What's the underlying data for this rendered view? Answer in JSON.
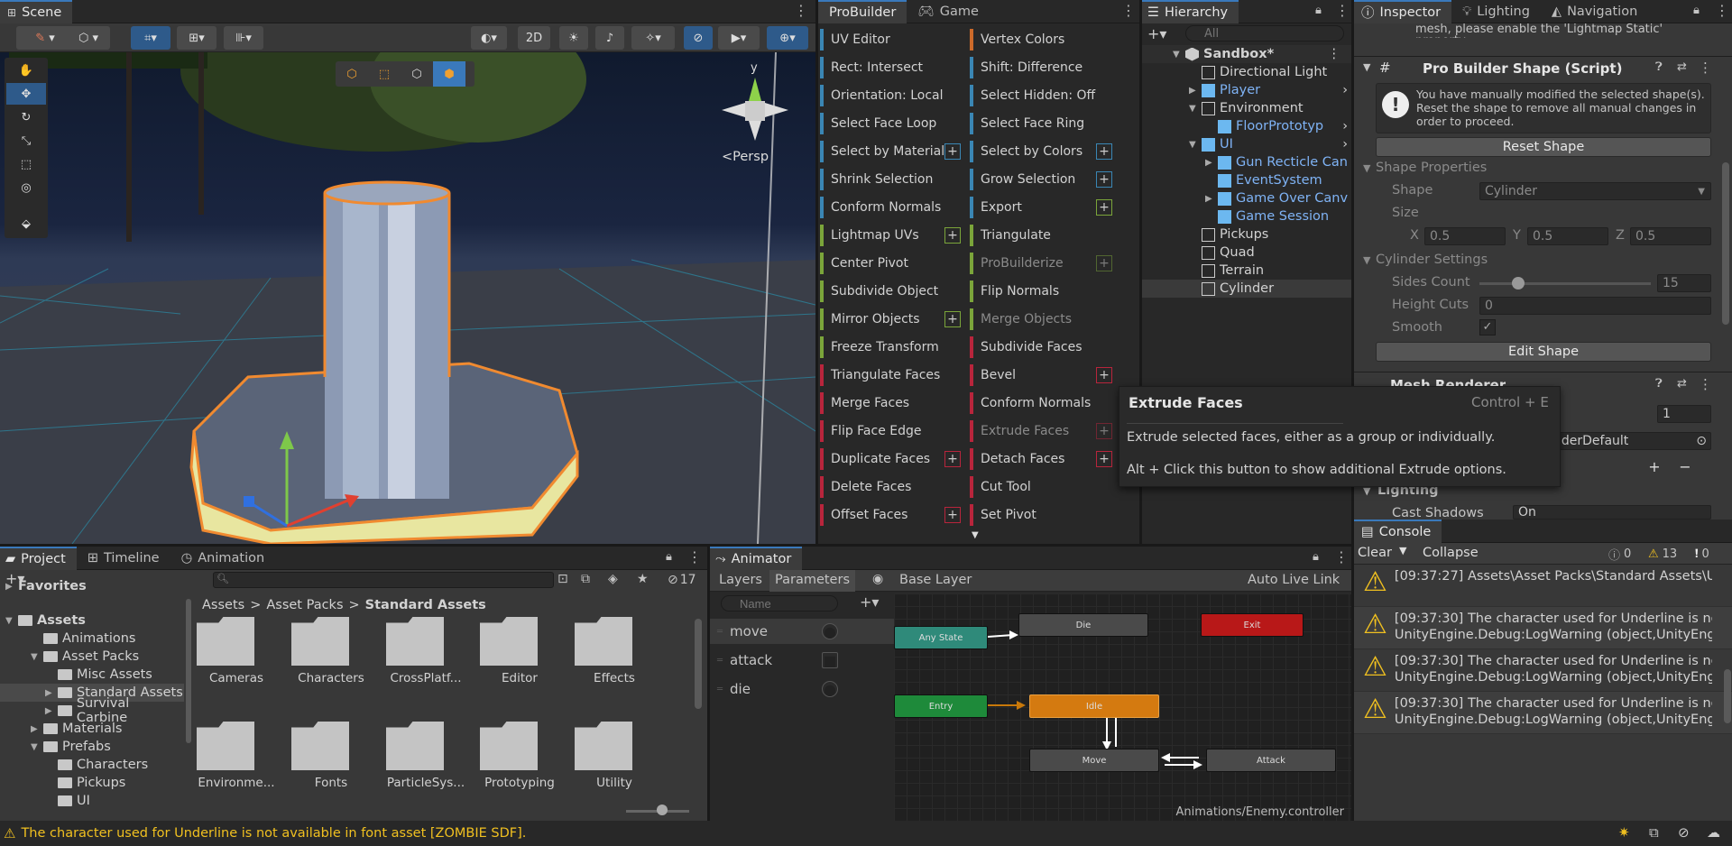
{
  "scene": {
    "tab": "Scene",
    "twod": "2D",
    "persp": "<Persp",
    "axis_y": "y"
  },
  "probuilder": {
    "tabs": [
      "ProBuilder",
      "Game"
    ],
    "left": [
      "UV Editor",
      "Rect: Intersect",
      "Orientation: Local",
      "Select Face Loop",
      "Select by Material",
      "Shrink Selection",
      "Conform Normals",
      "Lightmap UVs",
      "Center Pivot",
      "Subdivide Object",
      "Mirror Objects",
      "Freeze Transform",
      "Triangulate Faces",
      "Merge Faces",
      "Flip Face Edge",
      "Duplicate Faces",
      "Delete Faces",
      "Offset Faces"
    ],
    "right": [
      "Vertex Colors",
      "Shift: Difference",
      "Select Hidden: Off",
      "Select Face Ring",
      "Select by Colors",
      "Grow Selection",
      "Export",
      "Triangulate",
      "ProBuilderize",
      "Flip Normals",
      "Merge Objects",
      "Subdivide Faces",
      "Bevel",
      "Conform Normals",
      "Extrude Faces",
      "Detach Faces",
      "Cut Tool",
      "Set Pivot"
    ],
    "plus": "+"
  },
  "hierarchy": {
    "tab": "Hierarchy",
    "search_placeholder": "All",
    "plus": "+",
    "items": [
      "Sandbox*",
      "Directional Light",
      "Player",
      "Environment",
      "FloorPrototyp",
      "UI",
      "Gun Recticle Can",
      "EventSystem",
      "Game Over Canv",
      "Game Session",
      "Pickups",
      "Quad",
      "Terrain",
      "Cylinder"
    ]
  },
  "inspector": {
    "tabs": [
      "Inspector",
      "Lighting",
      "Navigation"
    ],
    "top_text": "mesh, please enable the 'Lightmap Static' property.",
    "component": "Pro Builder Shape (Script)",
    "warning": "You have manually modified the selected shape(s). Reset the shape to remove all manual changes in order to proceed.",
    "reset": "Reset Shape",
    "shape_props": "Shape Properties",
    "shape_label": "Shape",
    "shape_value": "Cylinder",
    "size": "Size",
    "x": "X",
    "y": "Y",
    "z": "Z",
    "sx": "0.5",
    "sy": "0.5",
    "sz": "0.5",
    "cyl": "Cylinder Settings",
    "sides": "Sides Count",
    "sides_val": "15",
    "hcuts": "Height Cuts",
    "hcuts_val": "0",
    "smooth": "Smooth",
    "smooth_check": "✓",
    "edit": "Edit Shape",
    "mesh": "Mesh Renderer",
    "val1": "1",
    "mat": "lderDefault",
    "lighting": "Lighting",
    "cast": "Cast Shadows",
    "cast_val": "On"
  },
  "tooltip": {
    "title": "Extrude Faces",
    "shortcut": "Control + E",
    "line1": "Extrude selected faces, either as a group or individually.",
    "line2": "Alt + Click this button to show additional Extrude options."
  },
  "console": {
    "tab": "Console",
    "clear": "Clear",
    "collapse": "Collapse",
    "c0": "0",
    "c13": "13",
    "c0b": "0",
    "rows": [
      {
        "a": "[09:37:27] Assets\\Asset Packs\\Standard Assets\\U",
        "b": ""
      },
      {
        "a": "[09:37:30] The character used for Underline is no",
        "b": "UnityEngine.Debug:LogWarning (object,UnityEng"
      },
      {
        "a": "[09:37:30] The character used for Underline is no",
        "b": "UnityEngine.Debug:LogWarning (object,UnityEng"
      },
      {
        "a": "[09:37:30] The character used for Underline is no",
        "b": "UnityEngine.Debug:LogWarning (object,UnityEng"
      }
    ]
  },
  "project": {
    "tabs": [
      "Project",
      "Timeline",
      "Animation"
    ],
    "count": "17",
    "plus": "+",
    "breadcrumb": [
      "Assets",
      "Asset Packs",
      "Standard Assets"
    ],
    "sep": ">",
    "tree": [
      "Favorites",
      "Assets",
      "Animations",
      "Asset Packs",
      "Misc Assets",
      "Standard Assets",
      "Survival Carbine",
      "Materials",
      "Prefabs",
      "Characters",
      "Pickups",
      "UI"
    ],
    "folders": [
      "Cameras",
      "Characters",
      "CrossPlatf...",
      "Editor",
      "Effects",
      "Environme...",
      "Fonts",
      "ParticleSys...",
      "Prototyping",
      "Utility"
    ]
  },
  "animator": {
    "tab": "Animator",
    "layers": "Layers",
    "parameters": "Parameters",
    "base": "Base Layer",
    "live": "Auto Live Link",
    "name_placeholder": "Name",
    "plus": "+",
    "params": [
      "move",
      "attack",
      "die"
    ],
    "nodes": {
      "any": "Any State",
      "die": "Die",
      "exit": "Exit",
      "entry": "Entry",
      "idle": "Idle",
      "move": "Move",
      "attack": "Attack"
    },
    "path": "Animations/Enemy.controller"
  },
  "status": {
    "message": "The character used for Underline is not available in font asset [ZOMBIE SDF]."
  }
}
